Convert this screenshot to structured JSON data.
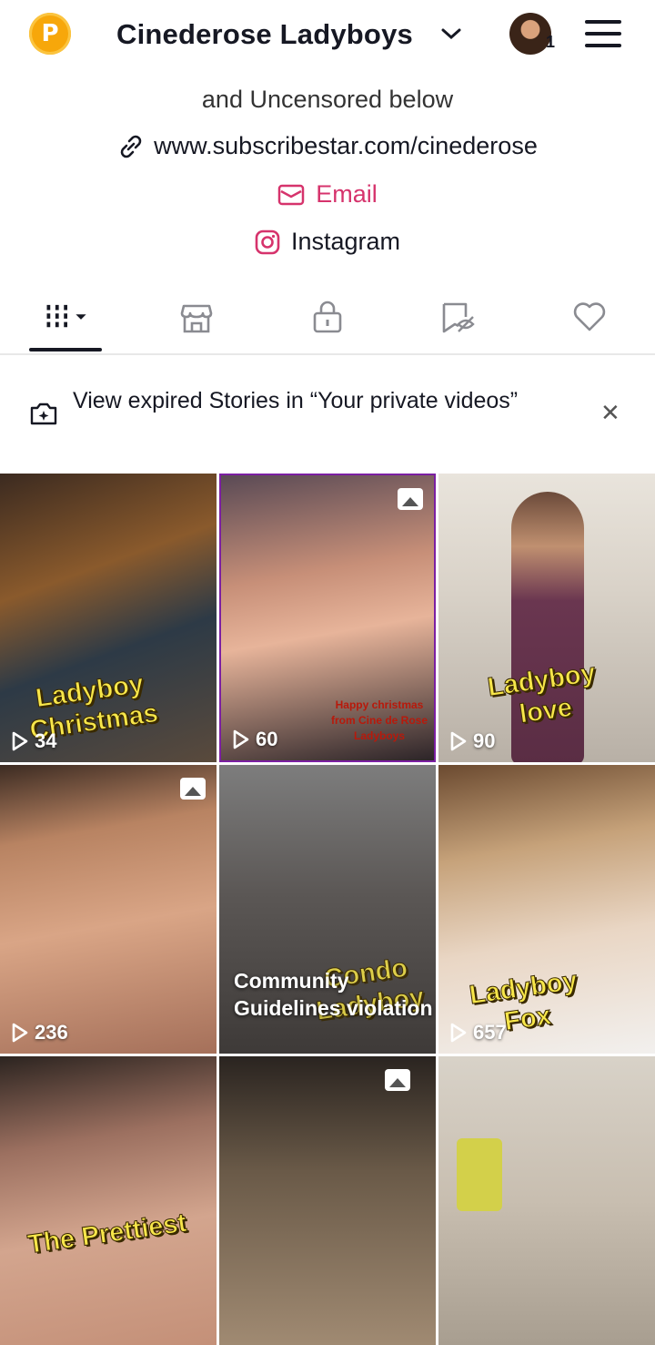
{
  "header": {
    "coin_label": "P",
    "title": "Cinederose Ladyboys",
    "notification_count": "1"
  },
  "bio": {
    "line": "and Uncensored below",
    "link": "www.subscribestar.com/cinederose",
    "email": "Email",
    "instagram": "Instagram"
  },
  "tabs": [
    {
      "icon": "grid-icon"
    },
    {
      "icon": "shop-icon"
    },
    {
      "icon": "lock-icon"
    },
    {
      "icon": "hidden-bookmark-icon"
    },
    {
      "icon": "heart-icon"
    }
  ],
  "banner": {
    "text": "View expired Stories in “Your private videos”"
  },
  "videos": [
    {
      "views": "34",
      "overlay": "Ladyboy\nChristmas"
    },
    {
      "views": "60",
      "caption": "Happy christmas from Cine de Rose Ladyboys"
    },
    {
      "views": "90",
      "overlay": "Ladyboy\nlove"
    },
    {
      "views": "236"
    },
    {
      "views": "",
      "notice": "Community Guidelines violation",
      "overlay": "Condo\nLadyboy"
    },
    {
      "views": "657",
      "overlay": "Ladyboy\nFox"
    },
    {
      "views": "",
      "overlay": "The Prettiest"
    },
    {
      "views": ""
    },
    {
      "views": ""
    }
  ],
  "colors": {
    "accent_pink": "#d6336c",
    "coin": "#f7a70a",
    "text": "#161823"
  }
}
